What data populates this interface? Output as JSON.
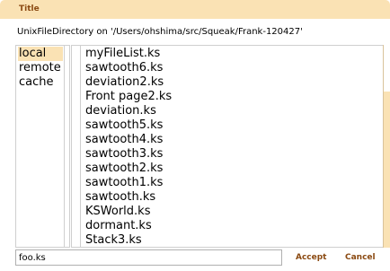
{
  "window": {
    "title": "Title",
    "directory_label": "UnixFileDirectory on '/Users/ohshima/src/Squeak/Frank-120427'"
  },
  "volumes": {
    "items": [
      {
        "label": "local",
        "selected": true
      },
      {
        "label": "remote",
        "selected": false
      },
      {
        "label": "cache",
        "selected": false
      }
    ]
  },
  "files": {
    "items": [
      "myFileList.ks",
      "sawtooth6.ks",
      "deviation2.ks",
      "Front page2.ks",
      "deviation.ks",
      "sawtooth5.ks",
      "sawtooth4.ks",
      "sawtooth3.ks",
      "sawtooth2.ks",
      "sawtooth1.ks",
      "sawtooth.ks",
      "KSWorld.ks",
      "dormant.ks",
      "Stack3.ks"
    ]
  },
  "footer": {
    "filename_value": "foo.ks",
    "accept_label": "Accept",
    "cancel_label": "Cancel"
  },
  "colors": {
    "accent": "#fae2b4",
    "button_text": "#8b4a12"
  }
}
